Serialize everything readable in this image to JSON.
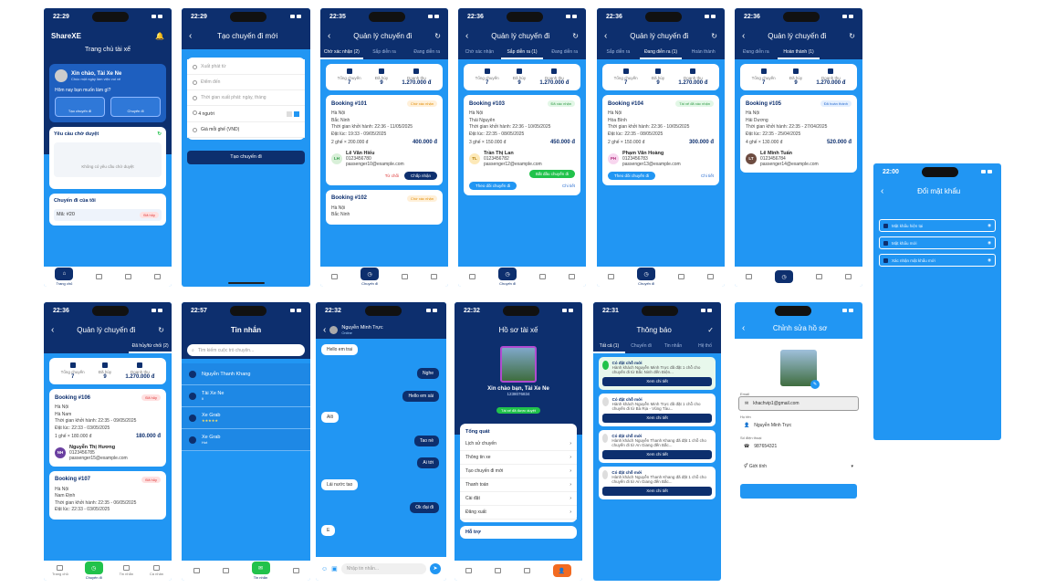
{
  "common": {
    "manage_trips": "Quản lý chuyến đi",
    "stats": {
      "l1": "Tổng chuyến",
      "v1": "7",
      "l2": "Đã hủy",
      "v2": "9",
      "l3": "Doanh thu",
      "v3": "1.270.000 đ"
    },
    "nav": {
      "home": "Trang chủ",
      "trips": "Chuyến đi",
      "msg": "Tin nhắn",
      "profile": "Cá nhân"
    },
    "hanoi": "Hà Nội",
    "detail_link": "Chi tiết",
    "track_btn": "Theo dõi chuyến đi"
  },
  "s1": {
    "time": "22:29",
    "brand": "ShareXE",
    "subtitle": "Trang chủ tài xế",
    "greet": "Xin chào, Tài Xe Ne",
    "greet_sub": "Chúc một ngày làm việc vui vẻ",
    "question": "Hôm nay bạn muốn làm gì?",
    "act1": "Tạo chuyến đi",
    "act2": "Chuyến đi",
    "pending_title": "Yêu cầu chờ duyệt",
    "pending_empty": "Không có yêu cầu chờ duyệt",
    "mytrips": "Chuyến đi của tôi",
    "trip_code": "Mã: #20",
    "trip_status": "Đã hủy"
  },
  "s2": {
    "time": "22:29",
    "title": "Tạo chuyến đi mới",
    "from": "Xuất phát từ",
    "to": "Điểm đến",
    "when": "Thời gian xuất phát: ngày, tháng",
    "seats": "4 người",
    "price": "Giá mỗi ghế (VND)",
    "submit": "Tạo chuyến đi"
  },
  "s3": {
    "time": "22:35",
    "tabs": [
      "Chờ xác nhận (2)",
      "Sắp diễn ra",
      "Đang diễn ra",
      "Hoàn thành"
    ],
    "booking": "Booking #101",
    "status": "Chờ xác nhận",
    "dest": "Bắc Ninh",
    "depart": "Thời gian khởi hành: 22:36 - 11/05/2025",
    "arrive": "Đặt lúc: 19:33 - 09/05/2025",
    "seats": "2 ghế × 200.000 đ",
    "total": "400.000 đ",
    "name": "Lê Văn Hiếu",
    "initials": "LH",
    "phone": "0123456780",
    "email": "passenger10@example.com",
    "reject": "Từ chối",
    "accept": "Chấp nhận",
    "booking2": "Booking #102",
    "dest2": "Bắc Ninh"
  },
  "s4": {
    "time": "22:36",
    "tabs": [
      "Chờ xác nhận",
      "Sắp diễn ra (1)",
      "Đang diễn ra",
      "Hoàn thành"
    ],
    "booking": "Booking #103",
    "status": "Đã xác nhận",
    "dest": "Thái Nguyên",
    "depart": "Thời gian khởi hành: 22:36 - 10/05/2025",
    "arrive": "Đặt lúc: 22:35 - 08/05/2025",
    "seats": "3 ghế × 150.000 đ",
    "total": "450.000 đ",
    "name": "Trần Thị Lan",
    "initials": "TL",
    "phone": "0123456782",
    "email": "passenger12@example.com",
    "start": "Bắt đầu chuyến đi"
  },
  "s5": {
    "time": "22:36",
    "tabs": [
      "Chờ xác nhận",
      "Sắp diễn ra",
      "Đang diễn ra (1)",
      "Hoàn thành"
    ],
    "booking": "Booking #104",
    "status": "Tài xế đã xác nhận",
    "dest": "Hòa Bình",
    "depart": "Thời gian khởi hành: 22:36 - 10/05/2025",
    "arrive": "Đặt lúc: 22:35 - 08/05/2025",
    "seats": "2 ghế × 150.000 đ",
    "total": "300.000 đ",
    "name": "Phạm Văn Hoàng",
    "initials": "PH",
    "phone": "0123456783",
    "email": "passenger13@example.com"
  },
  "s6": {
    "time": "22:36",
    "tabs": [
      "Chờ xác nhận",
      "Sắp diễn ra",
      "Đang diễn ra",
      "Hoàn thành (1)"
    ],
    "booking": "Booking #105",
    "status": "Đã hoàn thành",
    "dest": "Hải Dương",
    "depart": "Thời gian khởi hành: 22:35 - 27/04/2025",
    "arrive": "Đặt lúc: 22:35 - 25/04/2025",
    "seats": "4 ghế × 130.000 đ",
    "total": "520.000 đ",
    "name": "Lê Minh Tuấn",
    "initials": "LT",
    "phone": "0123456784",
    "email": "passenger14@example.com"
  },
  "s7": {
    "time": "22:00",
    "title": "Đổi mật khẩu",
    "f1": "Mật khẩu hiện tại",
    "f2": "Mật khẩu mới",
    "f3": "Xác nhận mật khẩu mới"
  },
  "s8": {
    "time": "22:36",
    "tab_right": "Đã hủy/từ chối (2)",
    "booking": "Booking #106",
    "status": "Đã hủy",
    "dest": "Hà Nam",
    "depart": "Thời gian khởi hành: 22:35 - 09/05/2025",
    "arrive": "Đặt lúc: 22:33 - 03/05/2025",
    "seats": "1 ghế × 180.000 đ",
    "total": "180.000 đ",
    "name": "Nguyễn Thị Hương",
    "initials": "NH",
    "phone": "0123456785",
    "email": "passenger15@example.com",
    "booking2": "Booking #107",
    "status2": "Đã hủy",
    "dest2": "Nam Định",
    "depart2": "Thời gian khởi hành: 22:35 - 06/05/2025",
    "arrive2": "Đặt lúc: 22:33 - 03/05/2025"
  },
  "s9": {
    "time": "22:57",
    "title": "Tin nhắn",
    "search": "Tìm kiếm cuộc trò chuyện...",
    "items": [
      {
        "name": "Nguyễn Thanh Khang",
        "sub": ""
      },
      {
        "name": "Tài Xe Ne",
        "sub": "Ii"
      },
      {
        "name": "Xe Grab",
        "sub": "★★★★★"
      },
      {
        "name": "Xe Grab",
        "sub": "Hot"
      }
    ]
  },
  "s10": {
    "time": "22:32",
    "name": "Nguyễn Minh Trực",
    "status": "Online",
    "msgs": [
      "Hello em trai",
      "Nghe",
      "Hello em sài",
      "Alô",
      "Tao nè",
      "Ai tới",
      "Lái nước tao",
      "Ok đại đi",
      "E"
    ],
    "input": "Nhập tin nhắn..."
  },
  "s11": {
    "time": "22:32",
    "title": "Hồ sơ tài xế",
    "name": "Xin chào bạn, Tài Xe Ne",
    "phone": "1238076834",
    "verified": "Tài xế đã được duyệt",
    "section": "Tổng quát",
    "menu": [
      "Lịch sử chuyến",
      "Thông tin xe",
      "Tạo chuyến đi mới",
      "Thanh toán",
      "Cài đặt",
      "Đăng xuất"
    ],
    "support": "Hỗ trợ"
  },
  "s12": {
    "time": "22:31",
    "title": "Thông báo",
    "tabs": [
      "Tất cả (1)",
      "Chuyến đi",
      "Tin nhắn",
      "Hệ thố"
    ],
    "cards": [
      {
        "title": "Có đặt chỗ mới",
        "text": "Hành khách Nguyễn Minh Trực đã đặt 1 chỗ cho chuyến đi từ Bắc Ninh đến Điện...",
        "btn": "Xem chi tiết"
      },
      {
        "title": "Có đặt chỗ mới",
        "text": "Hành khách Nguyễn Minh Trực đã đặt 1 chỗ cho chuyến đi từ Bà Rịa - Vũng Tàu...",
        "btn": "Xem chi tiết"
      },
      {
        "title": "Có đặt chỗ mới",
        "text": "Hành khách Nguyễn Thanh Khang đã đặt 1 chỗ cho chuyến đi từ An Giang đến Bắc...",
        "btn": "Xem chi tiết"
      },
      {
        "title": "Có đặt chỗ mới",
        "text": "Hành khách Nguyễn Thanh Khang đã đặt 1 chỗ cho chuyến đi từ An Giang đến Bắc...",
        "btn": "Xem chi tiết"
      }
    ]
  },
  "s13": {
    "title": "Chỉnh sửa hồ sơ",
    "email_label": "Email",
    "email": "khachvip1@gmail.com",
    "name_label": "Họ tên",
    "name": "Nguyễn Minh Trực",
    "phone_label": "Số điện thoại",
    "phone": "987654321",
    "gender": "Giới tính"
  }
}
